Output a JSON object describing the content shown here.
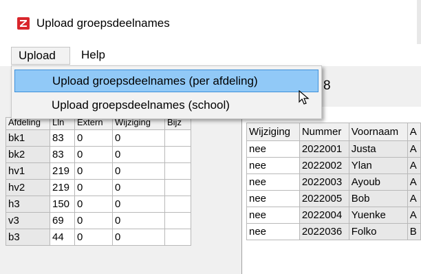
{
  "window": {
    "title": "Upload groepsdeelnames"
  },
  "menubar": {
    "items": [
      {
        "label": "Upload"
      },
      {
        "label": "Help"
      }
    ]
  },
  "dropdown": {
    "items": [
      {
        "label": "Upload groepsdeelnames (per afdeling)",
        "selected": true
      },
      {
        "label": "Upload groepsdeelnames (school)",
        "selected": false
      }
    ]
  },
  "partial_digit": "8",
  "left_grid": {
    "headers": [
      "Afdeling",
      "Lln",
      "Extern",
      "Wijziging",
      "Bijz"
    ],
    "rows": [
      [
        "bk1",
        "83",
        "0",
        "0",
        ""
      ],
      [
        "bk2",
        "83",
        "0",
        "0",
        ""
      ],
      [
        "hv1",
        "219",
        "0",
        "0",
        ""
      ],
      [
        "hv2",
        "219",
        "0",
        "0",
        ""
      ],
      [
        "h3",
        "150",
        "0",
        "0",
        ""
      ],
      [
        "v3",
        "69",
        "0",
        "0",
        ""
      ],
      [
        "b3",
        "44",
        "0",
        "0",
        ""
      ]
    ]
  },
  "right_grid": {
    "headers": [
      "Wijziging",
      "Nummer",
      "Voornaam",
      "A"
    ],
    "rows": [
      [
        "nee",
        "2022001",
        "Justa",
        "A"
      ],
      [
        "nee",
        "2022002",
        "Ylan",
        "A"
      ],
      [
        "nee",
        "2022003",
        "Ayoub",
        "A"
      ],
      [
        "nee",
        "2022005",
        "Bob",
        "A"
      ],
      [
        "nee",
        "2022004",
        "Yuenke",
        "A"
      ],
      [
        "nee",
        "2022036",
        "Folko",
        "B"
      ]
    ]
  },
  "colors": {
    "selection": "#91c9f7",
    "selection_border": "#3d8fd9",
    "icon_red": "#d9262c"
  }
}
